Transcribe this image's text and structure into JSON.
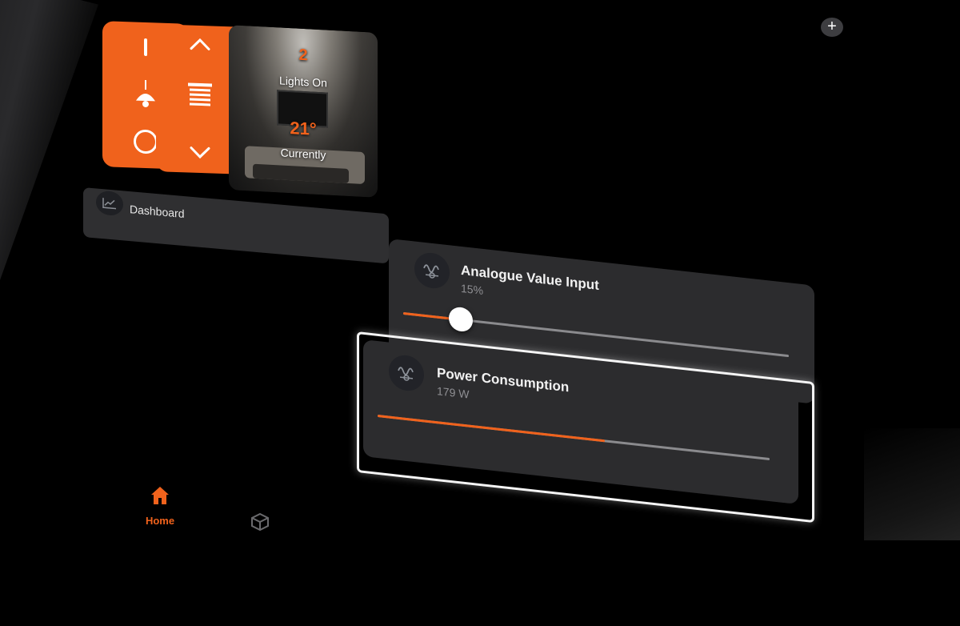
{
  "tiles": {
    "light_on_symbol": "|",
    "light_off_symbol": "○",
    "blind_up_symbol": "^",
    "blind_down_symbol": "v",
    "room": {
      "count": "2",
      "lights_label": "Lights On",
      "temperature": "21°",
      "temperature_label": "Currently"
    }
  },
  "dashboard": {
    "label": "Dashboard",
    "icon": "chart-line-icon"
  },
  "add_button": {
    "label": "+"
  },
  "analogue": {
    "title": "Analogue Value Input",
    "value": "15%",
    "level": 0.15
  },
  "power": {
    "title": "Power Consumption",
    "value": "179 W",
    "level": 0.58
  },
  "nav": {
    "home_label": "Home",
    "home_icon": "home-icon",
    "cube_icon": "cube-icon"
  },
  "colors": {
    "accent": "#f0621c",
    "card": "#2c2c2e",
    "background": "#000000"
  }
}
